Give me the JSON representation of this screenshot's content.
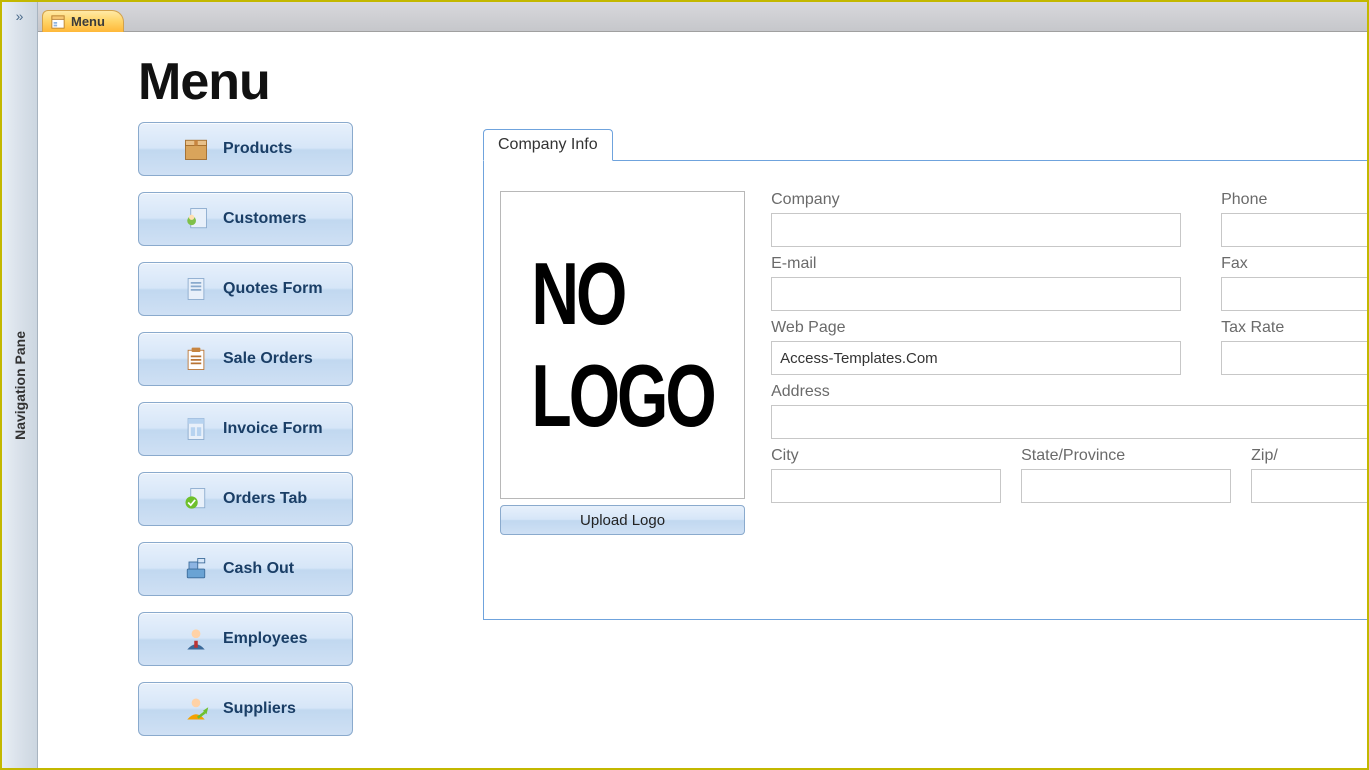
{
  "navPane": {
    "label": "Navigation Pane",
    "expandGlyph": "»"
  },
  "tab": {
    "label": "Menu"
  },
  "page": {
    "title": "Menu"
  },
  "menu": {
    "items": [
      {
        "label": "Products",
        "icon": "box-icon"
      },
      {
        "label": "Customers",
        "icon": "person-card-icon"
      },
      {
        "label": "Quotes Form",
        "icon": "document-icon"
      },
      {
        "label": "Sale Orders",
        "icon": "clipboard-list-icon"
      },
      {
        "label": "Invoice Form",
        "icon": "invoice-icon"
      },
      {
        "label": "Orders Tab",
        "icon": "check-doc-icon"
      },
      {
        "label": "Cash Out",
        "icon": "cash-register-icon"
      },
      {
        "label": "Employees",
        "icon": "employee-icon"
      },
      {
        "label": "Suppliers",
        "icon": "supplier-icon"
      }
    ]
  },
  "companyPanel": {
    "tabLabel": "Company Info",
    "logoPlaceholder": "NO LOGO",
    "uploadLabel": "Upload Logo",
    "fields": {
      "company": {
        "label": "Company",
        "value": ""
      },
      "phone": {
        "label": "Phone",
        "value": ""
      },
      "email": {
        "label": "E-mail",
        "value": ""
      },
      "fax": {
        "label": "Fax",
        "value": ""
      },
      "webpage": {
        "label": "Web Page",
        "value": "Access-Templates.Com"
      },
      "taxrate": {
        "label": "Tax Rate",
        "value": ""
      },
      "address": {
        "label": "Address",
        "value": ""
      },
      "city": {
        "label": "City",
        "value": ""
      },
      "state": {
        "label": "State/Province",
        "value": ""
      },
      "zip": {
        "label": "Zip/",
        "value": ""
      }
    }
  }
}
